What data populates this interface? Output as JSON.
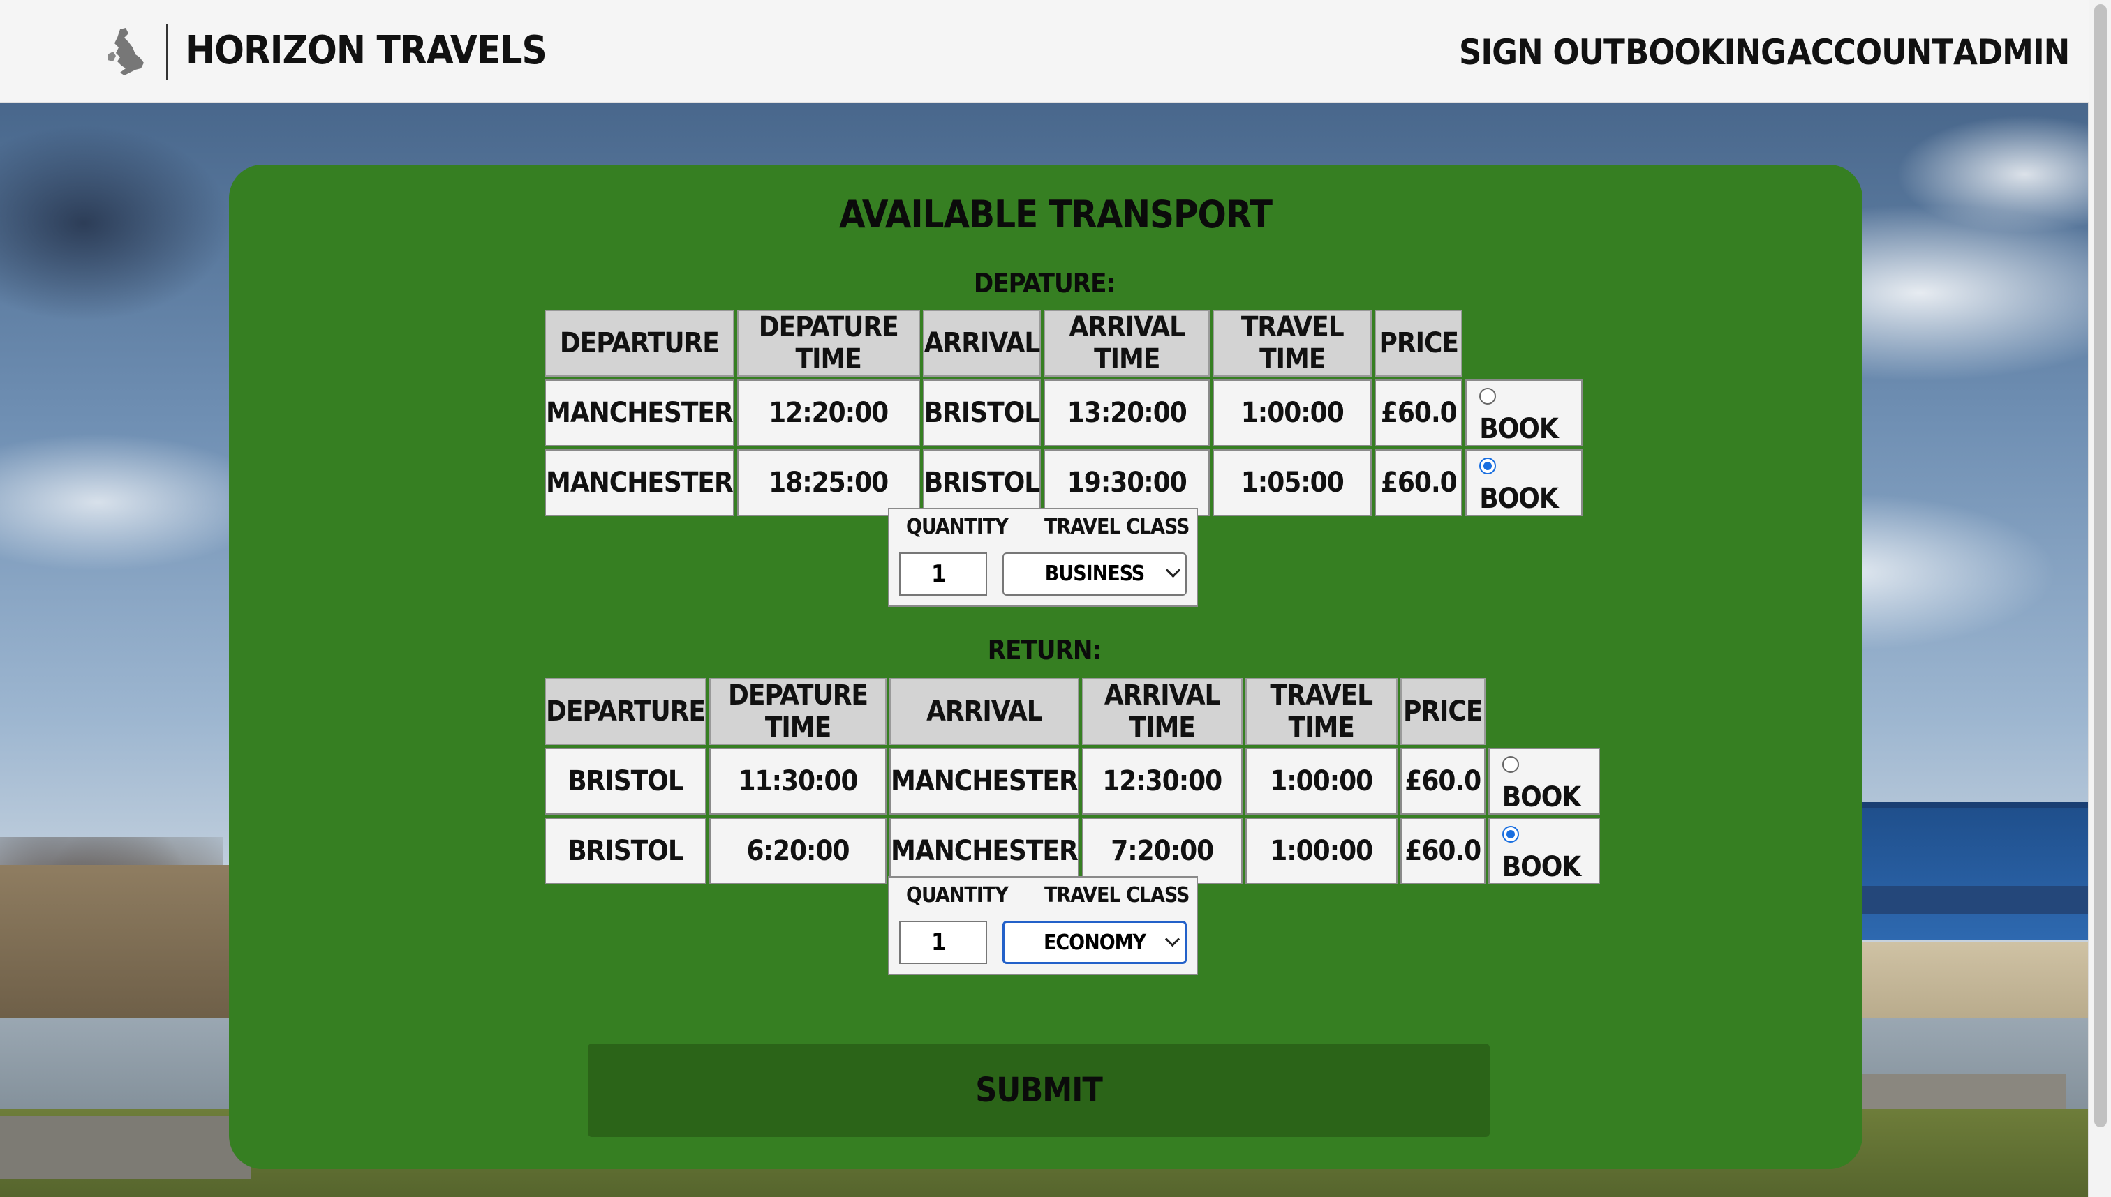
{
  "header": {
    "brand": "HORIZON TRAVELS",
    "nav": [
      "SIGN OUT",
      "BOOKING",
      "ACCOUNT",
      "ADMIN"
    ]
  },
  "page": {
    "title": "AVAILABLE TRANSPORT"
  },
  "departure": {
    "label": "DEPATURE:",
    "columns": [
      "DEPARTURE",
      "DEPATURE TIME",
      "ARRIVAL",
      "ARRIVAL TIME",
      "TRAVEL TIME",
      "PRICE"
    ],
    "rows": [
      {
        "departure": "MANCHESTER",
        "dep_time": "12:20:00",
        "arrival": "BRISTOL",
        "arr_time": "13:20:00",
        "travel": "1:00:00",
        "price": "£60.0",
        "book": "BOOK",
        "selected": false
      },
      {
        "departure": "MANCHESTER",
        "dep_time": "18:25:00",
        "arrival": "BRISTOL",
        "arr_time": "19:30:00",
        "travel": "1:05:00",
        "price": "£60.0",
        "book": "BOOK",
        "selected": true
      }
    ],
    "quantity_label": "QUANTITY",
    "quantity_value": "1",
    "class_label": "TRAVEL CLASS",
    "class_value": "BUSINESS"
  },
  "return": {
    "label": "RETURN:",
    "columns": [
      "DEPARTURE",
      "DEPATURE TIME",
      "ARRIVAL",
      "ARRIVAL TIME",
      "TRAVEL TIME",
      "PRICE"
    ],
    "rows": [
      {
        "departure": "BRISTOL",
        "dep_time": "11:30:00",
        "arrival": "MANCHESTER",
        "arr_time": "12:30:00",
        "travel": "1:00:00",
        "price": "£60.0",
        "book": "BOOK",
        "selected": false
      },
      {
        "departure": "BRISTOL",
        "dep_time": "6:20:00",
        "arrival": "MANCHESTER",
        "arr_time": "7:20:00",
        "travel": "1:00:00",
        "price": "£60.0",
        "book": "BOOK",
        "selected": true
      }
    ],
    "quantity_label": "QUANTITY",
    "quantity_value": "1",
    "class_label": "TRAVEL CLASS",
    "class_value": "ECONOMY"
  },
  "submit_label": "SUBMIT",
  "colors": {
    "card": "#367f22",
    "submit": "#2b6418",
    "header": "#f5f5f5",
    "radio_selected": "#1a6fe0"
  },
  "icons": {
    "logo": "uk-map-icon"
  }
}
